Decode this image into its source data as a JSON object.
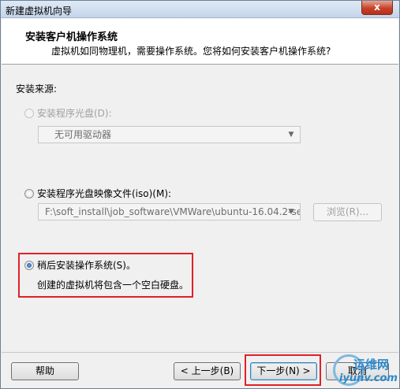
{
  "window": {
    "title": "新建虚拟机向导",
    "close_glyph": "x"
  },
  "header": {
    "title": "安装客户机操作系统",
    "subtitle": "虚拟机如同物理机，需要操作系统。您将如何安装客户机操作系统?"
  },
  "install_source": {
    "label": "安装来源:",
    "disc_option": {
      "label": "安装程序光盘(D):",
      "enabled": false,
      "selected": false
    },
    "disc_combo": {
      "value": "无可用驱动器",
      "enabled": false
    },
    "iso_option": {
      "label": "安装程序光盘映像文件(iso)(M):",
      "enabled": true,
      "selected": false
    },
    "iso_combo": {
      "value": "F:\\soft_install\\job_software\\VMWare\\ubuntu-16.04.2-se",
      "enabled": false
    },
    "browse_button": "浏览(R)...",
    "later_option": {
      "label": "稍后安装操作系统(S)。",
      "selected": true
    },
    "later_desc": "创建的虚拟机将包含一个空白硬盘。"
  },
  "footer": {
    "help": "帮助",
    "back": "< 上一步(B)",
    "next": "下一步(N) >",
    "cancel": "取消"
  },
  "watermark": {
    "top": "运维网",
    "bottom": "iyunv.com"
  },
  "colors": {
    "highlight_border": "#e0202a",
    "radio_selected": "#1a4fa8"
  }
}
